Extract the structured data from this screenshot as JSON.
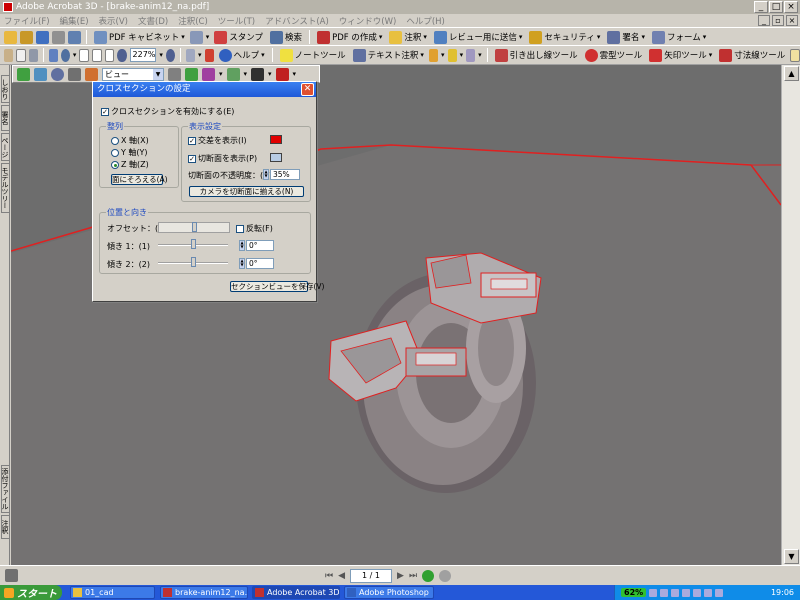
{
  "window": {
    "title": "Adobe Acrobat 3D - [brake-anim12_na.pdf]"
  },
  "menu": [
    "ファイル(F)",
    "編集(E)",
    "表示(V)",
    "文書(D)",
    "注釈(C)",
    "ツール(T)",
    "アドバンスト(A)",
    "ウィンドウ(W)",
    "ヘルプ(H)"
  ],
  "toolbar1": {
    "pdf_cabinet": "PDF キャビネット",
    "stamp": "スタンプ",
    "search": "検索",
    "pdf_create": "PDF の作成",
    "annotate": "注釈",
    "send_review": "レビュー用に送信",
    "security": "セキュリティ",
    "sign": "署名",
    "form": "フォーム"
  },
  "toolbar2": {
    "zoom": "227%",
    "help": "ヘルプ",
    "note_tool": "ノートツール",
    "text_annot": "テキスト注釈",
    "callout_tool": "引き出し線ツール",
    "cloud_tool": "雲型ツール",
    "arrow_tool": "矢印ツール",
    "dimension_tool": "寸法線ツール"
  },
  "toolbar3": {
    "view_select": "ビュー"
  },
  "sidebar_tabs": [
    "しおり",
    "署名",
    "ページ",
    "モデルツリー",
    "添付ファイル",
    "注釈"
  ],
  "dialog": {
    "title": "クロスセクションの設定",
    "enable_label": "クロスセクションを有効にする(E)",
    "enable_checked": true,
    "align": {
      "label": "整列",
      "options": [
        "X 軸(X)",
        "Y 軸(Y)",
        "Z 軸(Z)"
      ],
      "selected": 2,
      "face_button": "面にそろえる(A)"
    },
    "display": {
      "label": "表示設定",
      "show_intersect": "交差を表示(I)",
      "show_intersect_color": "#e00000",
      "show_section": "切断面を表示(P)",
      "show_section_color": "#b8cce4",
      "opacity_label": "切断面の不透明度：(U)",
      "opacity_value": "35%",
      "align_camera_button": "カメラを切断面に揃える(N)"
    },
    "position": {
      "label": "位置と向き",
      "offset_label": "オフセット：(O)",
      "flip_label": "反転(F)",
      "tilt1_label": "傾き 1：(1)",
      "tilt1_value": "0°",
      "tilt2_label": "傾き 2：(2)",
      "tilt2_value": "0°"
    },
    "save_button": "セクションビューを保存(V)"
  },
  "statusbar": {
    "page": "1 / 1"
  },
  "taskbar": {
    "start": "スタート",
    "items": [
      "01_cad",
      "brake-anim12_na.pdf",
      "Adobe Acrobat 3D - ...",
      "Adobe Photoshop"
    ],
    "battery": "62%",
    "clock": "19:06"
  }
}
